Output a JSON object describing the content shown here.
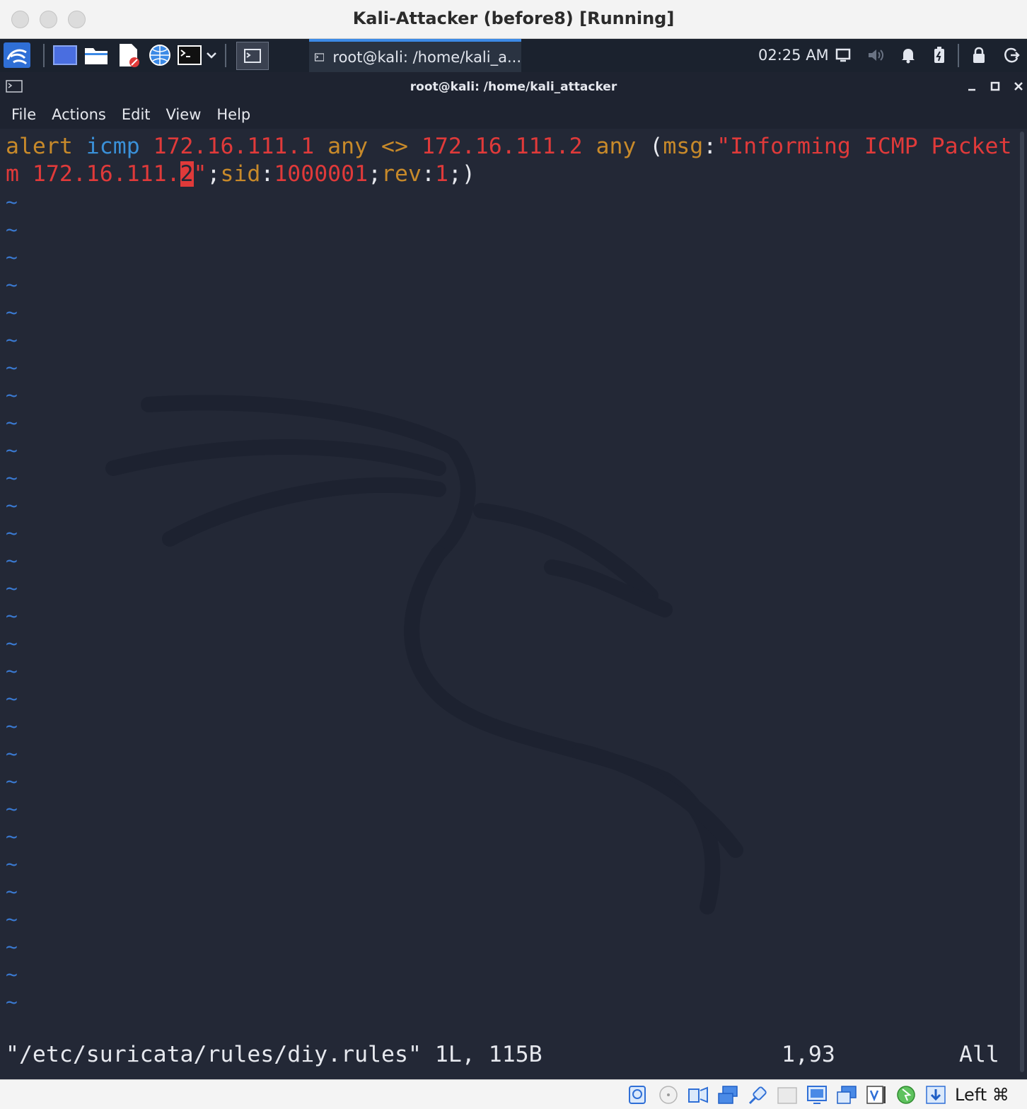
{
  "window": {
    "title": "Kali-Attacker (before8) [Running]"
  },
  "panel": {
    "task_label": "root@kali: /home/kali_a...",
    "clock": "02:25 AM"
  },
  "terminal": {
    "title": "root@kali: /home/kali_attacker",
    "menu": [
      "File",
      "Actions",
      "Edit",
      "View",
      "Help"
    ],
    "line1": {
      "w1": "alert",
      "w2": "icmp",
      "w3": "172.16.111.1",
      "w4": "any",
      "w5": "<>",
      "w6": "172.16.111.2",
      "w7": "any",
      "w8": "(",
      "w9": "msg",
      "w10": ":",
      "w11": "\"Informing ICMP Packet fro"
    },
    "line2": {
      "w1": "m 172.16.111.",
      "cursor": "2",
      "w2": "\"",
      "w3": ";",
      "w4": "sid",
      "w5": ":",
      "w6": "1000001",
      "w7": ";",
      "w8": "rev",
      "w9": ":",
      "w10": "1",
      "w11": ";)"
    },
    "tilde": "~",
    "status": {
      "file": "\"/etc/suricata/rules/diy.rules\" 1L, 115B",
      "position": "1,93",
      "scroll": "All"
    }
  },
  "vbox": {
    "host_key": "Left ⌘"
  },
  "colors": {
    "keyword_red": "#e03a3a",
    "keyword_orange": "#c88a2a",
    "keyword_blue": "#3a90d8",
    "tilde_blue": "#3a79d0",
    "terminal_bg": "#232836"
  }
}
